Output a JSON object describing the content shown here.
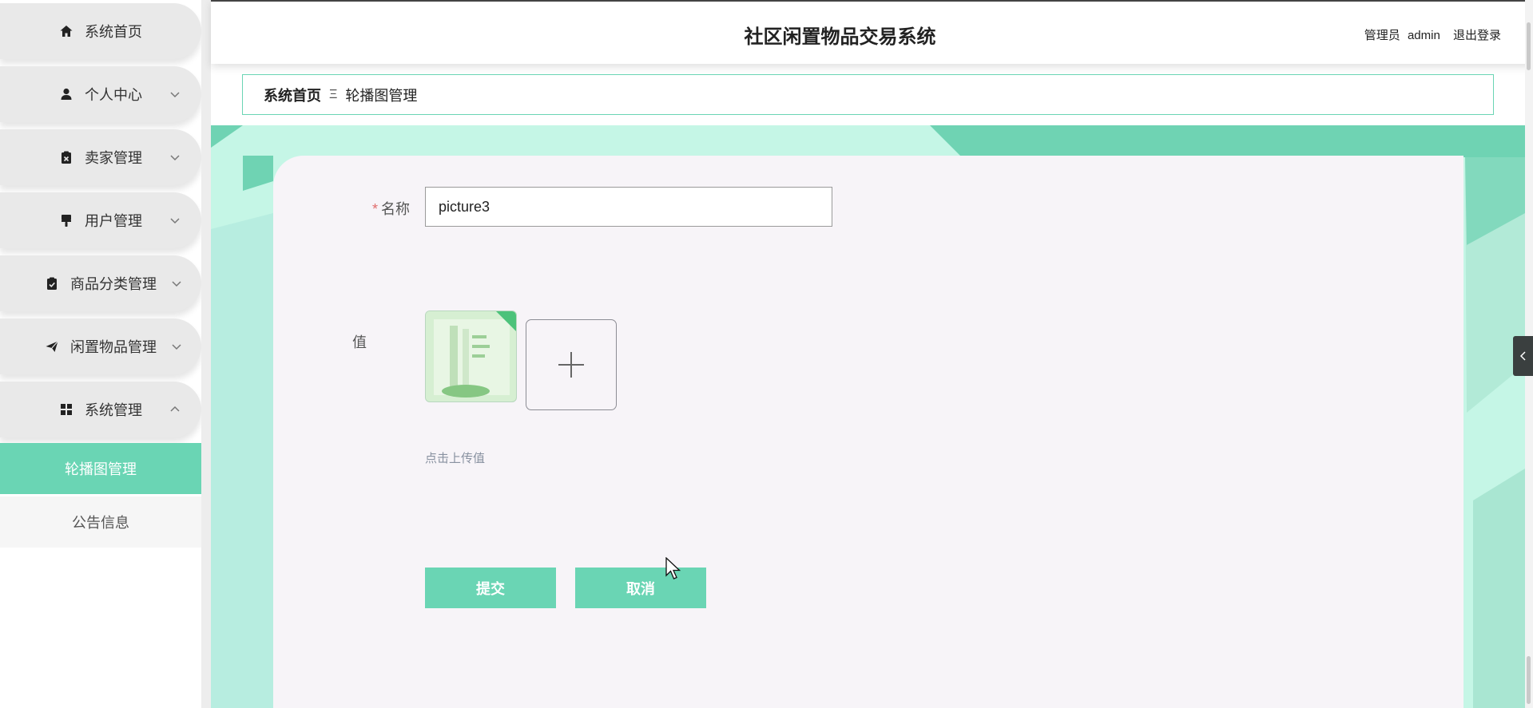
{
  "app": {
    "title": "社区闲置物品交易系统"
  },
  "header": {
    "user_role_label": "管理员",
    "username": "admin",
    "logout_label": "退出登录"
  },
  "sidebar": {
    "items": [
      {
        "label": "系统首页",
        "icon": "home-icon",
        "expandable": false
      },
      {
        "label": "个人中心",
        "icon": "user-icon",
        "expandable": true,
        "expanded": false
      },
      {
        "label": "卖家管理",
        "icon": "clipboard-x-icon",
        "expandable": true,
        "expanded": false
      },
      {
        "label": "用户管理",
        "icon": "brush-icon",
        "expandable": true,
        "expanded": false
      },
      {
        "label": "商品分类管理",
        "icon": "clipboard-check-icon",
        "expandable": true,
        "expanded": false
      },
      {
        "label": "闲置物品管理",
        "icon": "paper-plane-icon",
        "expandable": true,
        "expanded": false
      },
      {
        "label": "系统管理",
        "icon": "grid-icon",
        "expandable": true,
        "expanded": true
      }
    ],
    "sub_items": [
      {
        "label": "轮播图管理",
        "active": true
      },
      {
        "label": "公告信息",
        "active": false
      }
    ]
  },
  "breadcrumb": {
    "home": "系统首页",
    "separator": "Ξ",
    "current": "轮播图管理"
  },
  "form": {
    "name_label": "名称",
    "name_required_mark": "*",
    "name_value": "picture3",
    "value_label": "值",
    "upload_hint": "点击上传值",
    "submit_label": "提交",
    "cancel_label": "取消"
  },
  "colors": {
    "accent": "#6ad5b4",
    "sidebar_item_bg": "#e9e9e9",
    "content_bg": "#c5f6e6",
    "form_bg": "#f7f4f8",
    "required_mark": "#e06c6c"
  }
}
